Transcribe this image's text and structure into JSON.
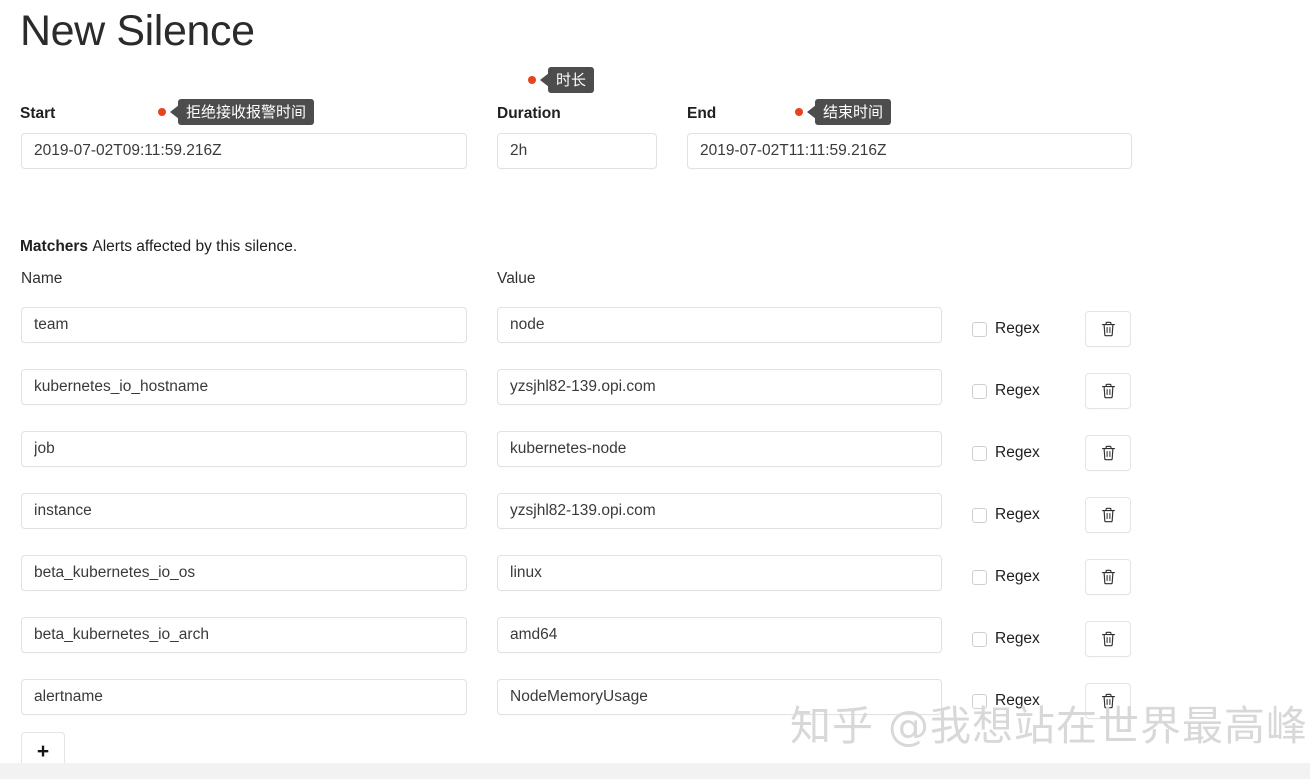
{
  "page": {
    "title": "New Silence",
    "watermark": "知乎 @我想站在世界最高峰",
    "accent_dot_color": "#e8431f",
    "tooltip_bg": "#4d4d4d"
  },
  "schedule": {
    "start": {
      "label": "Start",
      "value": "2019-07-02T09:11:59.216Z",
      "tooltip": "拒绝接收报警时间"
    },
    "duration": {
      "label": "Duration",
      "value": "2h",
      "tooltip": "时长"
    },
    "end": {
      "label": "End",
      "value": "2019-07-02T11:11:59.216Z",
      "tooltip": "结束时间"
    }
  },
  "matchers": {
    "heading": "Matchers",
    "description": "Alerts affected by this silence.",
    "columns": {
      "name": "Name",
      "value": "Value"
    },
    "regex_label": "Regex",
    "add_label": "+",
    "delete_icon": "trash-icon",
    "rows": [
      {
        "name": "team",
        "value": "node",
        "regex": false
      },
      {
        "name": "kubernetes_io_hostname",
        "value": "yzsjhl82-139.opi.com",
        "regex": false
      },
      {
        "name": "job",
        "value": "kubernetes-node",
        "regex": false
      },
      {
        "name": "instance",
        "value": "yzsjhl82-139.opi.com",
        "regex": false
      },
      {
        "name": "beta_kubernetes_io_os",
        "value": "linux",
        "regex": false
      },
      {
        "name": "beta_kubernetes_io_arch",
        "value": "amd64",
        "regex": false
      },
      {
        "name": "alertname",
        "value": "NodeMemoryUsage",
        "regex": false
      }
    ]
  }
}
